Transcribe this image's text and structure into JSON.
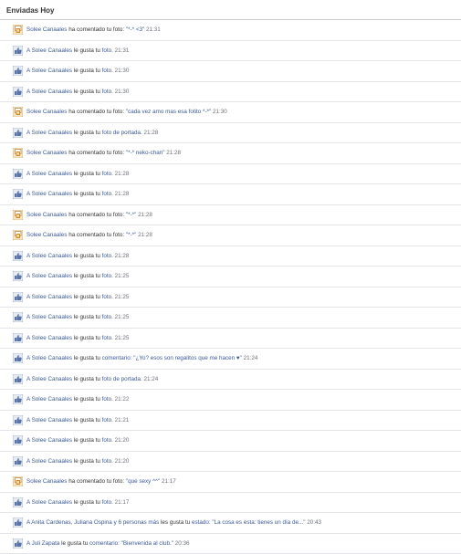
{
  "header": {
    "title": "Enviadas Hoy"
  },
  "notifications": [
    {
      "icon": "comment-icon",
      "actor": "Solee Canaales",
      "action": " ha comentado tu foto: ",
      "detail": "\"*-* <3\"",
      "time": "21:31"
    },
    {
      "icon": "like-icon",
      "actor": "A Solee Canaales",
      "action": " le gusta tu ",
      "detail": "foto.",
      "time": "21:31"
    },
    {
      "icon": "like-icon",
      "actor": "A Solee Canaales",
      "action": " le gusta tu ",
      "detail": "foto.",
      "time": "21:30"
    },
    {
      "icon": "like-icon",
      "actor": "A Solee Canaales",
      "action": " le gusta tu ",
      "detail": "foto.",
      "time": "21:30"
    },
    {
      "icon": "comment-icon",
      "actor": "Solee Canaales",
      "action": " ha comentado tu foto: ",
      "detail": "\"cada vez amo mas esa fotito *-*\"",
      "time": "21:30"
    },
    {
      "icon": "like-icon",
      "actor": "A Solee Canaales",
      "action": " le gusta tu ",
      "detail": "foto de portada.",
      "time": "21:28"
    },
    {
      "icon": "comment-icon",
      "actor": "Solee Canaales",
      "action": " ha comentado tu foto: ",
      "detail": "\"*-* neko-chan\"",
      "time": "21:28"
    },
    {
      "icon": "like-icon",
      "actor": "A Solee Canaales",
      "action": " le gusta tu ",
      "detail": "foto.",
      "time": "21:28"
    },
    {
      "icon": "like-icon",
      "actor": "A Solee Canaales",
      "action": " le gusta tu ",
      "detail": "foto.",
      "time": "21:28"
    },
    {
      "icon": "comment-icon",
      "actor": "Solee Canaales",
      "action": " ha comentado tu foto: ",
      "detail": "\"*-*\"",
      "time": "21:28"
    },
    {
      "icon": "comment-icon",
      "actor": "Solee Canaales",
      "action": " ha comentado tu foto: ",
      "detail": "\"*-*\"",
      "time": "21:28"
    },
    {
      "icon": "like-icon",
      "actor": "A Solee Canaales",
      "action": " le gusta tu ",
      "detail": "foto.",
      "time": "21:28"
    },
    {
      "icon": "like-icon",
      "actor": "A Solee Canaales",
      "action": " le gusta tu ",
      "detail": "foto.",
      "time": "21:25"
    },
    {
      "icon": "like-icon",
      "actor": "A Solee Canaales",
      "action": " le gusta tu ",
      "detail": "foto.",
      "time": "21:25"
    },
    {
      "icon": "like-icon",
      "actor": "A Solee Canaales",
      "action": " le gusta tu ",
      "detail": "foto.",
      "time": "21:25"
    },
    {
      "icon": "like-icon",
      "actor": "A Solee Canaales",
      "action": " le gusta tu ",
      "detail": "foto.",
      "time": "21:25"
    },
    {
      "icon": "like-icon",
      "actor": "A Solee Canaales",
      "action": " le gusta tu ",
      "detail": "comentario: \"¿Yo? esos son regalitos que me hacen ♥\"",
      "time": "21:24"
    },
    {
      "icon": "like-icon",
      "actor": "A Solee Canaales",
      "action": " le gusta tu ",
      "detail": "foto de portada.",
      "time": "21:24"
    },
    {
      "icon": "like-icon",
      "actor": "A Solee Canaales",
      "action": " le gusta tu ",
      "detail": "foto.",
      "time": "21:22"
    },
    {
      "icon": "like-icon",
      "actor": "A Solee Canaales",
      "action": " le gusta tu ",
      "detail": "foto.",
      "time": "21:21"
    },
    {
      "icon": "like-icon",
      "actor": "A Solee Canaales",
      "action": " le gusta tu ",
      "detail": "foto.",
      "time": "21:20"
    },
    {
      "icon": "like-icon",
      "actor": "A Solee Canaales",
      "action": " le gusta tu ",
      "detail": "foto.",
      "time": "21:20"
    },
    {
      "icon": "comment-icon",
      "actor": "Solee Canaales",
      "action": " ha comentado tu foto: ",
      "detail": "\"que sexy ^^\"",
      "time": "21:17"
    },
    {
      "icon": "like-icon",
      "actor": "A Solee Canaales",
      "action": " le gusta tu ",
      "detail": "foto.",
      "time": "21:17"
    },
    {
      "icon": "like-icon",
      "actor": "A Anita Cardenas, Juliana Ospina y 6 personas más",
      "action": " les gusta tu ",
      "detail": "estado: \"La cosa es esta: tienes un día de...\"",
      "time": "20:43"
    },
    {
      "icon": "like-icon",
      "actor": "A Juli Zapata",
      "action": " le gusta tu ",
      "detail": "comentario: \"Bienvenida al club.\"",
      "time": "20:36"
    }
  ],
  "colors": {
    "link": "#3b5998",
    "time": "#6b6f78",
    "divider": "#e4e6ea"
  }
}
